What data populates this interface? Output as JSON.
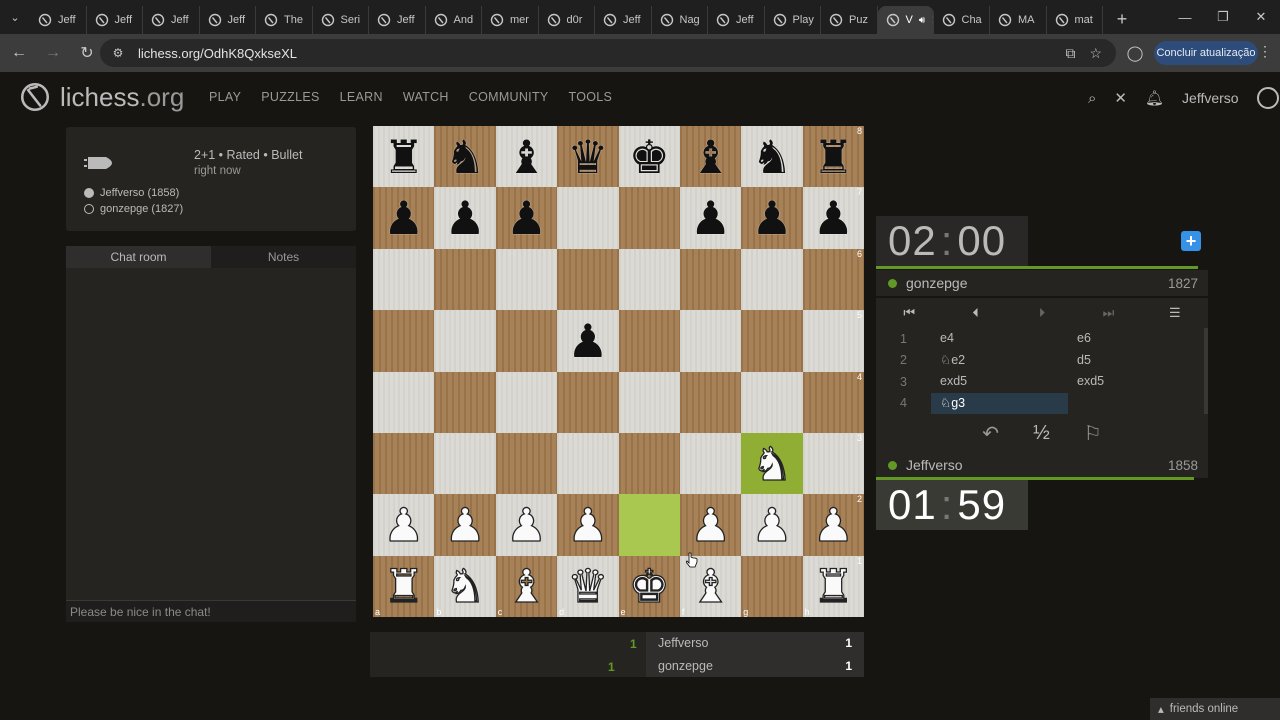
{
  "browser": {
    "tabs": [
      {
        "label": "Jeff"
      },
      {
        "label": "Jeff"
      },
      {
        "label": "Jeff"
      },
      {
        "label": "Jeff"
      },
      {
        "label": "The"
      },
      {
        "label": "Seri"
      },
      {
        "label": "Jeff"
      },
      {
        "label": "And"
      },
      {
        "label": "mer"
      },
      {
        "label": "d0r"
      },
      {
        "label": "Jeff"
      },
      {
        "label": "Nag"
      },
      {
        "label": "Jeff"
      },
      {
        "label": "Play"
      },
      {
        "label": "Puz"
      },
      {
        "label": "V"
      },
      {
        "label": "Cha"
      },
      {
        "label": "MA"
      },
      {
        "label": "mat"
      }
    ],
    "active_tab_index": 15,
    "url": "lichess.org/OdhK8QxkseXL",
    "update_button": "Concluir atualização"
  },
  "site": {
    "logo_text": "lichess",
    "logo_suffix": ".org",
    "nav": [
      "PLAY",
      "PUZZLES",
      "LEARN",
      "WATCH",
      "COMMUNITY",
      "TOOLS"
    ],
    "username": "Jeffverso"
  },
  "game": {
    "setup": "2+1 • Rated • Bullet",
    "time_ago": "right now",
    "white_player": "Jeffverso (1858)",
    "black_player": "gonzepge (1827)"
  },
  "chat": {
    "tab_chat": "Chat room",
    "tab_notes": "Notes",
    "placeholder": "Please be nice in the chat!"
  },
  "board": {
    "position": [
      [
        "br",
        "bn",
        "bb",
        "bq",
        "bk",
        "bb",
        "bn",
        "br"
      ],
      [
        "bp",
        "bp",
        "bp",
        "",
        "",
        "bp",
        "bp",
        "bp"
      ],
      [
        "",
        "",
        "",
        "",
        "",
        "",
        "",
        ""
      ],
      [
        "",
        "",
        "",
        "bp",
        "",
        "",
        "",
        ""
      ],
      [
        "",
        "",
        "",
        "",
        "",
        "",
        "",
        ""
      ],
      [
        "",
        "",
        "",
        "",
        "",
        "",
        "wn",
        ""
      ],
      [
        "wp",
        "wp",
        "wp",
        "wp",
        "",
        "wp",
        "wp",
        "wp"
      ],
      [
        "wr",
        "wn",
        "wb",
        "wq",
        "wk",
        "wb",
        "",
        "wr"
      ]
    ],
    "highlight": [
      "e2",
      "g3"
    ],
    "ranks": [
      "8",
      "7",
      "6",
      "5",
      "4",
      "3",
      "2",
      "1"
    ],
    "files": [
      "a",
      "b",
      "c",
      "d",
      "e",
      "f",
      "g",
      "h"
    ]
  },
  "clocks": {
    "top": {
      "min": "02",
      "sec": "00"
    },
    "bottom": {
      "min": "01",
      "sec": "59"
    }
  },
  "players": {
    "top": {
      "name": "gonzepge",
      "rating": "1827"
    },
    "bottom": {
      "name": "Jeffverso",
      "rating": "1858"
    }
  },
  "moves": [
    {
      "n": "1",
      "w": "e4",
      "b": "e6"
    },
    {
      "n": "2",
      "w": "♘e2",
      "b": "d5"
    },
    {
      "n": "3",
      "w": "exd5",
      "b": "exd5"
    },
    {
      "n": "4",
      "w": "♘g3",
      "b": ""
    }
  ],
  "crosstable": {
    "top": {
      "score": "1",
      "name": "Jeffverso",
      "total": "1"
    },
    "bottom": {
      "score": "1",
      "name": "gonzepge",
      "total": "1"
    }
  },
  "footer": {
    "friends": "friends online"
  },
  "colors": {
    "accent_green": "#629924",
    "move_highlight": "#8fae33",
    "board_dark": "#a27a4f",
    "board_light": "#dad9d3"
  }
}
